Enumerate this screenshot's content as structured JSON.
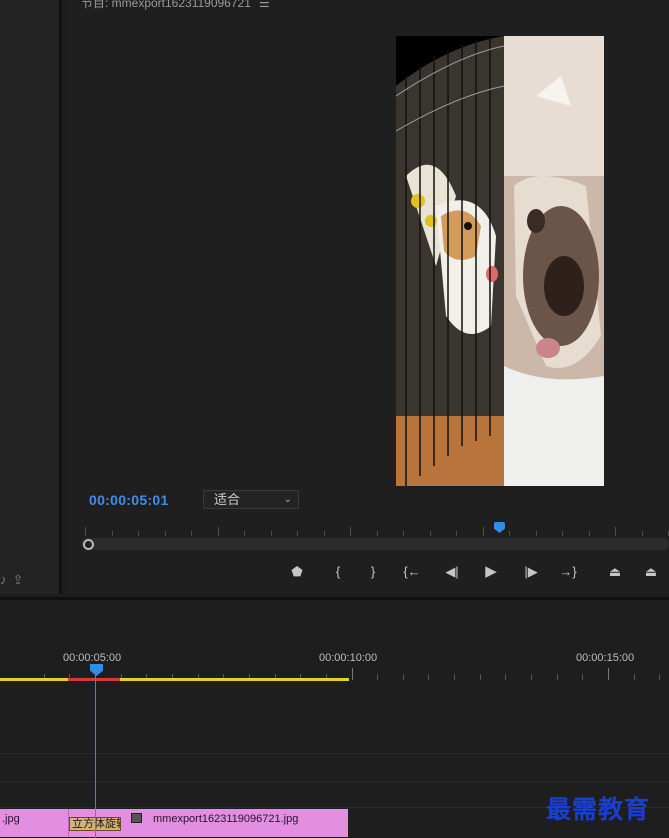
{
  "program": {
    "title": "节目: mmexport1623119096721",
    "menu_icon": "☰",
    "timecode": "00:00:05:01",
    "fit": "适合",
    "controls": [
      {
        "name": "marker-icon",
        "glyph": "⬟"
      },
      {
        "name": "mark-in-icon",
        "glyph": "{"
      },
      {
        "name": "mark-out-icon",
        "glyph": "}"
      },
      {
        "name": "go-to-in-icon",
        "glyph": "{←"
      },
      {
        "name": "step-back-icon",
        "glyph": "◀|"
      },
      {
        "name": "play-icon",
        "glyph": "▶"
      },
      {
        "name": "step-forward-icon",
        "glyph": "|▶"
      },
      {
        "name": "go-to-out-icon",
        "glyph": "→}"
      },
      {
        "name": "lift-icon",
        "glyph": "⏏"
      },
      {
        "name": "extract-icon",
        "glyph": "⏏"
      }
    ]
  },
  "timeline": {
    "ruler_labels": [
      "00:00:05:00",
      "00:00:10:00",
      "00:00:15:00"
    ],
    "clip_a_name": ".jpg",
    "transition": "立方体旋转",
    "clip_b_name": "mmexport1623119096721.jpg"
  },
  "watermark": "最需教育",
  "colors": {
    "accent": "#2f8de4",
    "clip": "#e28fe2",
    "work_area": "#e6cf2a"
  }
}
